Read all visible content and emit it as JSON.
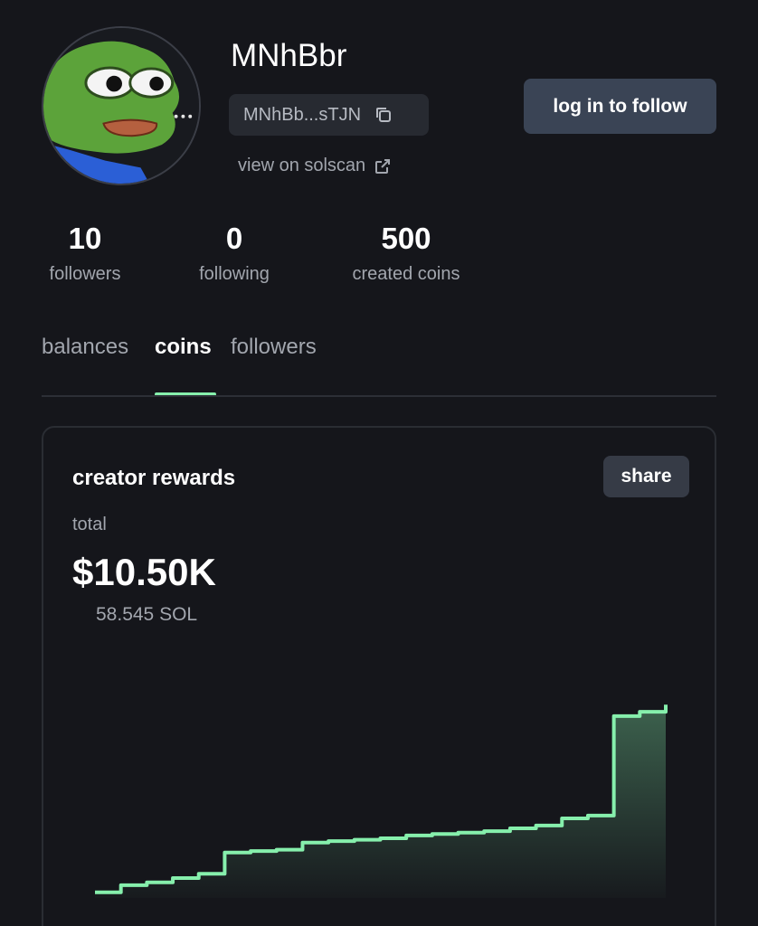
{
  "profile": {
    "username": "MNhBbr",
    "address_short": "MNhBb...sTJN",
    "solscan_label": "view on solscan",
    "follow_label": "log in to follow",
    "avatar_icon": "pepe-frog-avatar",
    "copy_icon": "copy-icon",
    "external_link_icon": "external-link-icon"
  },
  "stats": [
    {
      "value": "10",
      "label": "followers"
    },
    {
      "value": "0",
      "label": "following"
    },
    {
      "value": "500",
      "label": "created coins"
    }
  ],
  "tabs": [
    {
      "label": "balances",
      "active": false
    },
    {
      "label": "coins",
      "active": true
    },
    {
      "label": "followers",
      "active": false
    }
  ],
  "rewards": {
    "title": "creator rewards",
    "share_label": "share",
    "total_label": "total",
    "total_usd": "$10.50K",
    "total_sol": "58.545 SOL"
  },
  "colors": {
    "accent": "#86efac",
    "background": "#15161b",
    "button": "#3a4455"
  },
  "chart_data": {
    "type": "area",
    "x": [
      0,
      1,
      2,
      3,
      4,
      5,
      6,
      7,
      8,
      9,
      10,
      11,
      12,
      13,
      14,
      15,
      16,
      17,
      18,
      19,
      20,
      21,
      22
    ],
    "y": [
      0.2,
      0.45,
      0.55,
      0.7,
      0.85,
      1.6,
      1.65,
      1.7,
      1.95,
      2.0,
      2.05,
      2.1,
      2.2,
      2.25,
      2.3,
      2.35,
      2.45,
      2.55,
      2.8,
      2.9,
      6.4,
      6.55,
      6.8
    ],
    "ylim": [
      0,
      7
    ],
    "title": "",
    "xlabel": "",
    "ylabel": "",
    "grid": false,
    "legend": "none"
  }
}
